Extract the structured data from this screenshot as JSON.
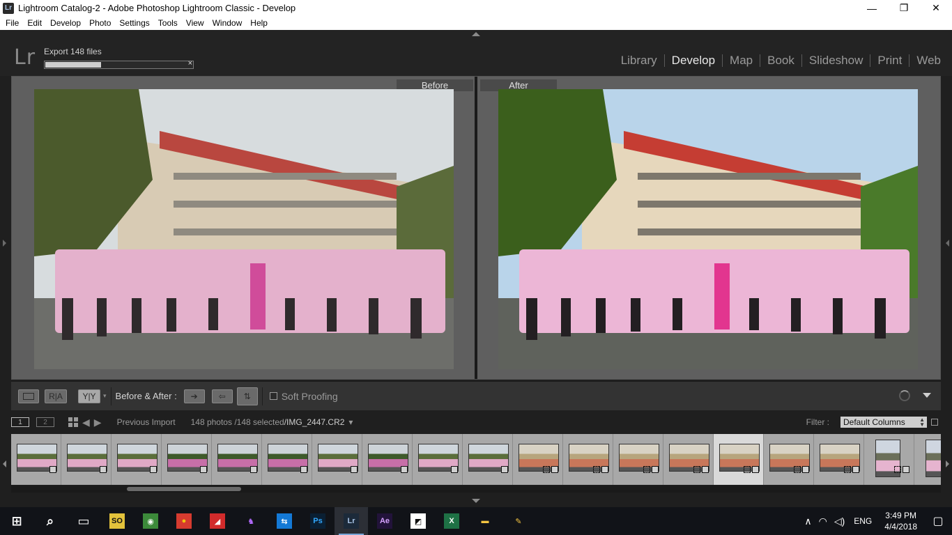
{
  "window": {
    "app_icon": "Lr",
    "title": "Lightroom Catalog-2 - Adobe Photoshop Lightroom Classic - Develop",
    "minimize": "—",
    "maximize": "❐",
    "close": "✕"
  },
  "menu": [
    "File",
    "Edit",
    "Develop",
    "Photo",
    "Settings",
    "Tools",
    "View",
    "Window",
    "Help"
  ],
  "header": {
    "logo": "Lr",
    "export_label": "Export 148 files",
    "export_progress": 0.4,
    "cancel": "×",
    "modules": [
      "Library",
      "Develop",
      "Map",
      "Book",
      "Slideshow",
      "Print",
      "Web"
    ],
    "active_module": "Develop"
  },
  "view": {
    "before_label": "Before",
    "after_label": "After"
  },
  "toolbar": {
    "loupe_icon": "loupe-view-icon",
    "ra_label": "R|A",
    "yy_label": "Y|Y",
    "before_after_label": "Before & After :",
    "soft_proofing_label": "Soft Proofing",
    "soft_proofing_checked": false
  },
  "filmstrip_header": {
    "monitor1": "1",
    "monitor2": "2",
    "source": "Previous Import",
    "count": "148 photos /148 selected",
    "filename": "/IMG_2447.CR2",
    "dropdown_arrow": "▾",
    "filter_label": "Filter :",
    "filter_value": "Default Columns"
  },
  "filmstrip": {
    "thumbnails": [
      {
        "style": "a"
      },
      {
        "style": "a"
      },
      {
        "style": "a"
      },
      {
        "style": "b"
      },
      {
        "style": "b"
      },
      {
        "style": "b"
      },
      {
        "style": "a"
      },
      {
        "style": "b"
      },
      {
        "style": "a"
      },
      {
        "style": "a"
      },
      {
        "style": "c"
      },
      {
        "style": "c"
      },
      {
        "style": "c"
      },
      {
        "style": "c"
      },
      {
        "style": "c",
        "selected": true
      },
      {
        "style": "c"
      },
      {
        "style": "c"
      },
      {
        "style": "p"
      },
      {
        "style": "p"
      }
    ]
  },
  "taskbar": {
    "icons": [
      {
        "name": "start-icon",
        "glyph": "⊞",
        "color": "#ffffff",
        "bg": "transparent"
      },
      {
        "name": "search-icon",
        "glyph": "⌕",
        "color": "#ffffff",
        "bg": "transparent"
      },
      {
        "name": "task-view-icon",
        "glyph": "▭",
        "color": "#ffffff",
        "bg": "transparent"
      },
      {
        "name": "app-so-icon",
        "glyph": "SO",
        "color": "#111111",
        "bg": "#e3c23b"
      },
      {
        "name": "app-green-icon",
        "glyph": "◉",
        "color": "#ffffff",
        "bg": "#3c8a3a"
      },
      {
        "name": "chrome-icon",
        "glyph": "●",
        "color": "#f2c20f",
        "bg": "#d63b2f"
      },
      {
        "name": "app-red-icon",
        "glyph": "◢",
        "color": "#ffffff",
        "bg": "#d22b2b"
      },
      {
        "name": "app-purple-icon",
        "glyph": "♞",
        "color": "#b36bff",
        "bg": "transparent"
      },
      {
        "name": "teamviewer-icon",
        "glyph": "⇆",
        "color": "#ffffff",
        "bg": "#1479d6"
      },
      {
        "name": "photoshop-icon",
        "glyph": "Ps",
        "color": "#31a8ff",
        "bg": "#0a1f33"
      },
      {
        "name": "lightroom-icon",
        "glyph": "Lr",
        "color": "#a9c4e6",
        "bg": "#1c2a3a",
        "active": true
      },
      {
        "name": "after-effects-icon",
        "glyph": "Ae",
        "color": "#d6a2ff",
        "bg": "#22133a"
      },
      {
        "name": "sticky-notes-icon",
        "glyph": "◩",
        "color": "#111111",
        "bg": "#ffffff"
      },
      {
        "name": "excel-icon",
        "glyph": "X",
        "color": "#ffffff",
        "bg": "#1e7145"
      },
      {
        "name": "file-explorer-icon",
        "glyph": "▬",
        "color": "#f5c542",
        "bg": "transparent"
      },
      {
        "name": "paint-icon",
        "glyph": "✎",
        "color": "#f5c542",
        "bg": "transparent"
      }
    ],
    "tray": {
      "chevron": "∧",
      "network": "◠",
      "volume": "◁)",
      "lang": "ENG",
      "time": "3:49 PM",
      "date": "4/4/2018",
      "notification": "▢"
    }
  }
}
